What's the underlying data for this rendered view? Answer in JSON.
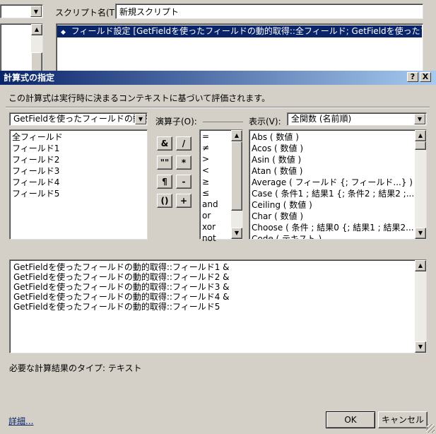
{
  "background": {
    "script_name_label": "スクリプト名(T):",
    "script_name_value": "新規スクリプト",
    "step_text": "フィールド設定 [GetFieldを使ったフィールドの動的取得::全フィールド; GetFieldを使ったフィールドの動的取"
  },
  "dialog": {
    "title": "計算式の指定",
    "help_btn": "?",
    "close_btn": "X",
    "description": "この計算式は実行時に決まるコンテキストに基づいて評価されます。",
    "table_select": "GetFieldを使ったフィールドの動的取",
    "fields": [
      "全フィールド",
      "フィールド1",
      "フィールド2",
      "フィールド3",
      "フィールド4",
      "フィールド5"
    ],
    "operators_label": "演算子(O):",
    "operator_buttons": [
      "&",
      "/",
      "\"\"",
      "*",
      "¶",
      "-",
      "()",
      "+"
    ],
    "operators_list": [
      "=",
      "≠",
      ">",
      "<",
      "≥",
      "≤",
      "and",
      "or",
      "xor",
      "not"
    ],
    "show_label": "表示(V):",
    "show_select": "全関数 (名前順)",
    "functions": [
      "Abs ( 数値 )",
      "Acos ( 数値 )",
      "Asin ( 数値 )",
      "Atan ( 数値 )",
      "Average ( フィールド {; フィールド...} )",
      "Case ( 条件1 ; 結果1 {; 条件2 ; 結果2 ;...",
      "Ceiling ( 数値 )",
      "Char ( 数値 )",
      "Choose ( 条件 ; 結果0 {; 結果1 ; 結果2...",
      "Code ( テキスト )"
    ],
    "formula_lines": [
      "GetFieldを使ったフィールドの動的取得::フィールド1 &",
      "GetFieldを使ったフィールドの動的取得::フィールド2 &",
      "GetFieldを使ったフィールドの動的取得::フィールド3 &",
      "GetFieldを使ったフィールドの動的取得::フィールド4 &",
      "GetFieldを使ったフィールドの動的取得::フィールド5"
    ],
    "result_type": "必要な計算結果のタイプ: テキスト",
    "details_link": "詳細...",
    "ok": "OK",
    "cancel": "キャンセル"
  }
}
